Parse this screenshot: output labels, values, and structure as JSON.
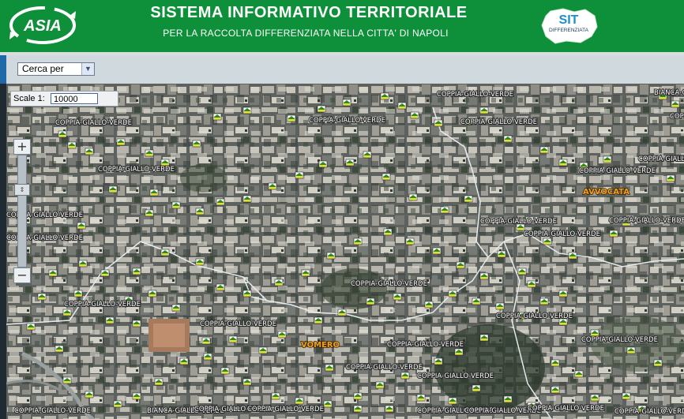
{
  "header": {
    "title": "SISTEMA INFORMATIVO TERRITORIALE",
    "subtitle": "PER LA RACCOLTA DIFFERENZIATA NELLA CITTA' DI NAPOLI",
    "logo_left_text": "ASIA",
    "logo_right_text": "SIT",
    "logo_right_caption": "DIFFERENZIATA"
  },
  "toolbar": {
    "search_select": {
      "selected": "Cerca per"
    }
  },
  "map": {
    "scale_label": "Scale 1:",
    "scale_value": "10000",
    "zoom_in": "+",
    "zoom_out": "−",
    "district_labels": [
      "AVVOCATA",
      "VOMERO"
    ],
    "bin_labels": [
      "COPPIA-GIALLO-VERDE",
      "COPPIA-GIALLO-VERDE",
      "COPPIA-GIALLO-VERDE",
      "COPPIA-GIALLO-VERDE",
      "COPPIA-GIALLO-VERDE",
      "BIANCA-GIALLO-VERDE",
      "COPPIA-GIALLO-VERDE",
      "COPPIA-GIALLO-VERDE",
      "COPPIA-GIALLO-VERDE",
      "COPPIA-GIALLO-VERDE",
      "COPPIA-GIALLO-VERDE",
      "COPPIA-GIALLO-VERDE",
      "COPPIA-GIALLO-VERDE",
      "COPPIA-GIALLO-VERDE",
      "COPPIA-GIALLO-VERDE",
      "COPPIA-GIALLO-VERDE",
      "COPPIA-GIALLO-VERDE",
      "COPPIA-GIALLO-VERDE",
      "COPPIA-GIALLO-VERDE",
      "COPPIA-GIALLO-VERDE",
      "COPPIA-GIALLO-VERDE",
      "COPPIA-GIALLO-VERDE",
      "BIANCA-GIALLO-VERDE",
      "COPPIA-GIALLO-VERDE",
      "COPPIA-GIALLO-VERDE",
      "COPPIA-GIALLO-VERDE",
      "COPPIA-GIALLO-VERDE",
      "COPPIA-GIALLO-VERDE",
      "COPPIA-GIALLO-VERDE",
      "COPPIA-GIALLO-VERDE",
      "COPPIA-GIALLO-VERDE"
    ]
  },
  "colors": {
    "header_green": "#0e8f3a",
    "bin_yellow": "#e8e020",
    "bin_green": "#1f8a1f",
    "district_orange": "#f0a020"
  }
}
